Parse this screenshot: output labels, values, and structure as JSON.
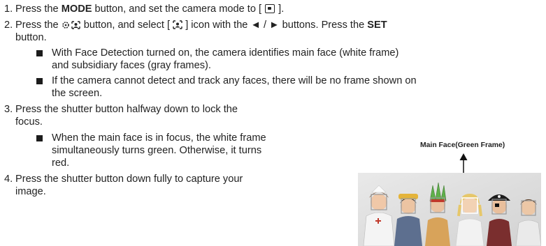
{
  "steps": [
    {
      "num": "1.",
      "parts": [
        "Press the ",
        "MODE",
        " button, and set the camera mode to [ ",
        "camera-mode-icon",
        " ]."
      ]
    },
    {
      "num": "2.",
      "parts": [
        "Press the ",
        "face-detection-button-icon",
        " button, and select [ ",
        "face-icon",
        " ] icon with the ◄ / ► buttons. Press the ",
        "SET"
      ],
      "cont": "button."
    },
    {
      "num": "3.",
      "line1": "Press the shutter button halfway down to lock the",
      "line2": "focus."
    },
    {
      "num": "4.",
      "line1": "Press the shutter button down fully to capture your",
      "line2": "image."
    }
  ],
  "notes": {
    "n1_l1": "With Face Detection turned on, the camera identifies main face (white frame)",
    "n1_l2": "and subsidiary faces (gray frames).",
    "n2_l1": "If the camera cannot detect and track any faces, there will be no frame shown on",
    "n2_l2": "the screen.",
    "n3_l1": "When the main face is in focus, the white frame",
    "n3_l2": "simultaneously turns green. Otherwise, it turns",
    "n3_l3": "red."
  },
  "figure": {
    "caption": "Main Face(Green Frame)"
  }
}
